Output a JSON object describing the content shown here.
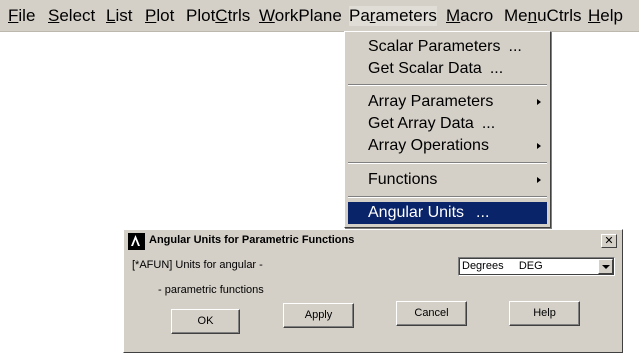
{
  "menubar": {
    "items": [
      {
        "pre": "",
        "u": "F",
        "post": "ile"
      },
      {
        "pre": "",
        "u": "S",
        "post": "elect"
      },
      {
        "pre": "",
        "u": "L",
        "post": "ist"
      },
      {
        "pre": "",
        "u": "P",
        "post": "lot"
      },
      {
        "pre": "Plot",
        "u": "C",
        "post": "trls"
      },
      {
        "pre": "",
        "u": "W",
        "post": "orkPlane"
      },
      {
        "pre": "Pa",
        "u": "r",
        "post": "ameters"
      },
      {
        "pre": "",
        "u": "M",
        "post": "acro"
      },
      {
        "pre": "Me",
        "u": "n",
        "post": "uCtrls"
      },
      {
        "pre": "",
        "u": "H",
        "post": "elp"
      }
    ]
  },
  "dropdown": {
    "items": [
      {
        "label": "Scalar Parameters",
        "dots": "...",
        "submenu": false
      },
      {
        "label": "Get Scalar Data",
        "dots": "...",
        "submenu": false
      },
      {
        "label": "Array Parameters",
        "dots": "",
        "submenu": true
      },
      {
        "label": "Get Array Data",
        "dots": "...",
        "submenu": false
      },
      {
        "label": "Array Operations",
        "dots": "",
        "submenu": true
      },
      {
        "label": "Functions",
        "dots": "",
        "submenu": true
      },
      {
        "label": "Angular Units",
        "dots": "...",
        "submenu": false,
        "selected": true
      }
    ]
  },
  "dialog": {
    "title": "Angular Units for Parametric Functions",
    "close_glyph": "✕",
    "prompt_line1": "[*AFUN]  Units for angular -",
    "prompt_line2": "- parametric functions",
    "select_value": "Degrees     DEG",
    "buttons": {
      "ok": "OK",
      "apply": "Apply",
      "cancel": "Cancel",
      "help": "Help"
    }
  }
}
